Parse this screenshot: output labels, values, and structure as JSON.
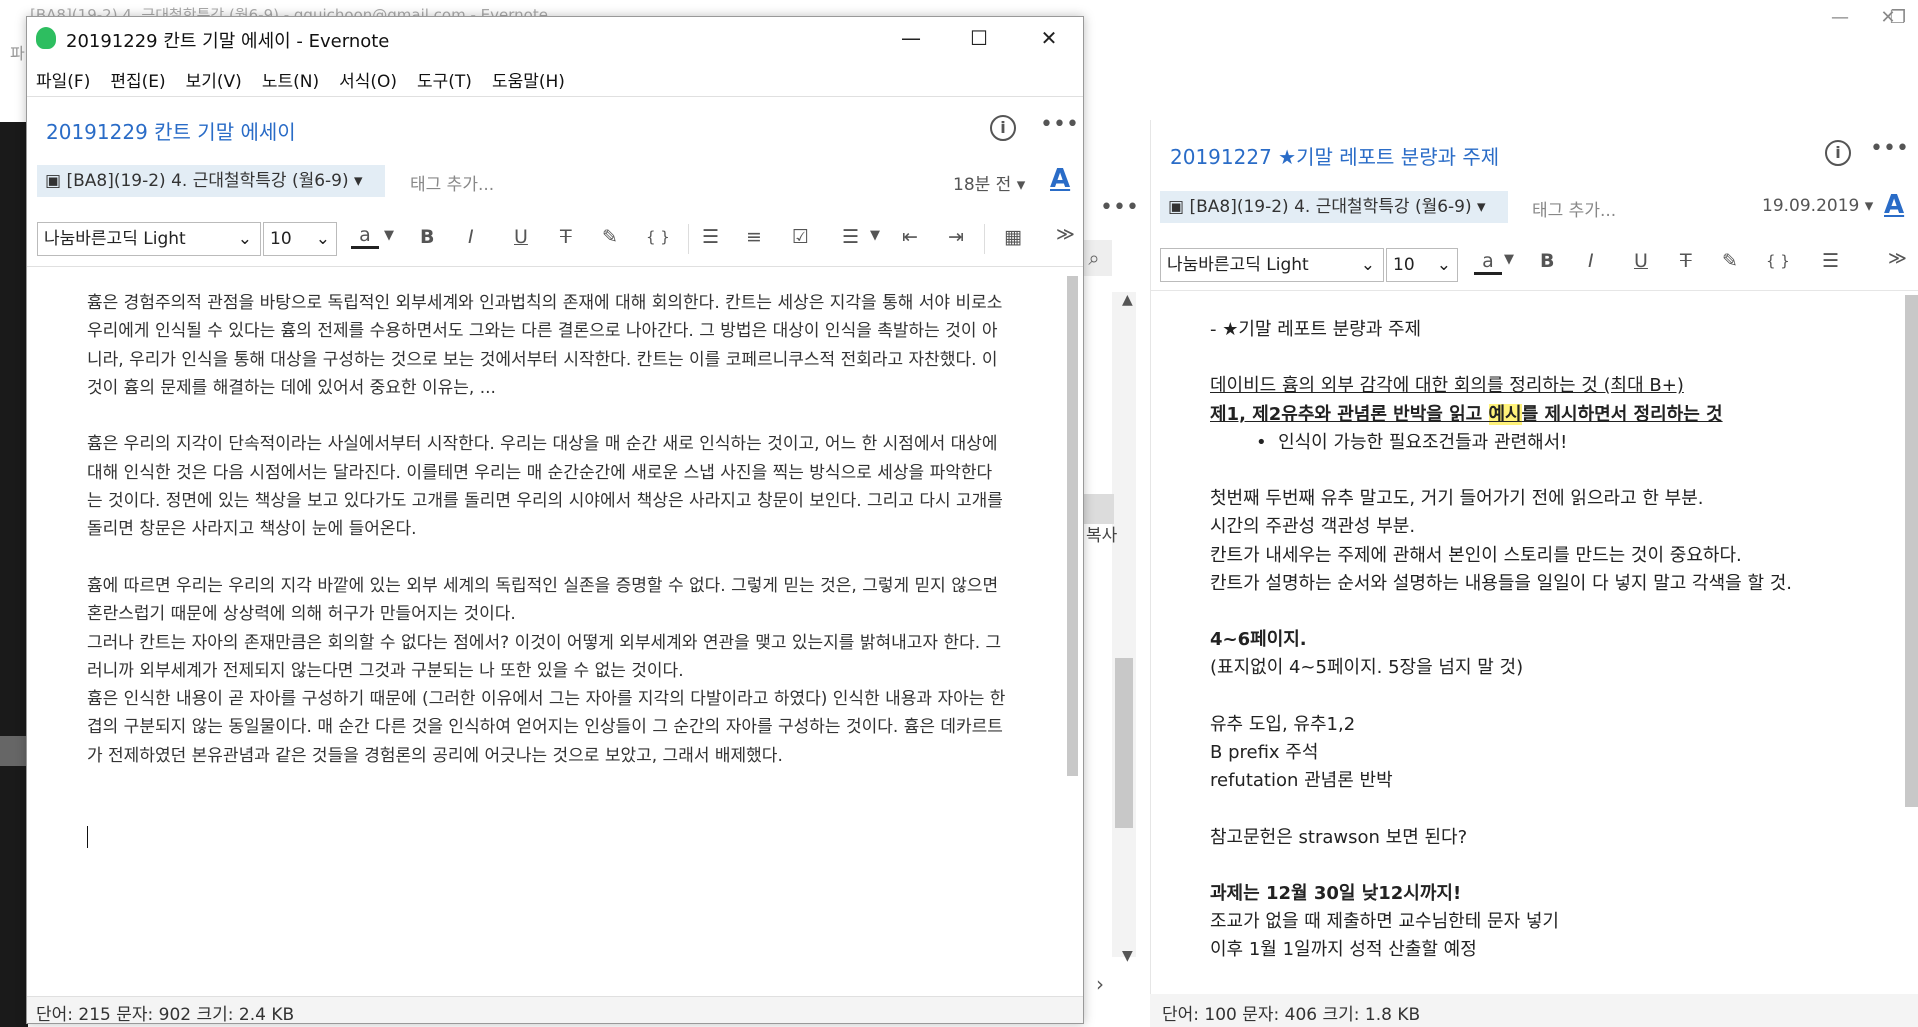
{
  "background_window": {
    "title": "[BA8](19-2) 4. 근대철학특강 (월6-9) - ggujchoon@gmail.com - Evernote",
    "menu_fragment": "파"
  },
  "front_window": {
    "title": "20191229 칸트 기말 에세이 - Evernote",
    "menu": [
      "파일(F)",
      "편집(E)",
      "보기(V)",
      "노트(N)",
      "서식(O)",
      "도구(T)",
      "도움말(H)"
    ],
    "note_title": "20191229 칸트 기말 에세이",
    "notebook": "[BA8](19-2) 4. 근대철학특강 (월6-9)",
    "tag_placeholder": "태그 추가...",
    "updated": "18분 전",
    "toolbar": {
      "font": "나눔바른고딕 Light",
      "size": "10",
      "color_label": "a",
      "bold": "B",
      "italic": "I",
      "underline": "U",
      "strike": "T",
      "code": "{ }"
    },
    "body_paragraphs": [
      "흄은 경험주의적 관점을 바탕으로 독립적인 외부세계와 인과법칙의 존재에 대해 회의한다. 칸트는 세상은 지각을 통해 서야 비로소 우리에게 인식될 수 있다는 흄의 전제를 수용하면서도 그와는 다른 결론으로 나아간다. 그 방법은 대상이 인식을 촉발하는 것이 아니라, 우리가 인식을 통해 대상을 구성하는 것으로 보는 것에서부터 시작한다. 칸트는 이를 코페르니쿠스적 전회라고 자찬했다. 이것이 흄의 문제를 해결하는 데에 있어서 중요한 이유는, ...",
      "",
      "흄은 우리의 지각이 단속적이라는 사실에서부터 시작한다. 우리는 대상을 매 순간 새로 인식하는 것이고, 어느 한 시점에서 대상에 대해 인식한 것은 다음 시점에서는 달라진다. 이를테면 우리는 매 순간순간에 새로운 스냅 사진을 찍는 방식으로 세상을 파악한다는 것이다. 정면에 있는 책상을 보고 있다가도 고개를 돌리면 우리의 시야에서 책상은 사라지고 창문이 보인다. 그리고 다시 고개를 돌리면 창문은 사라지고 책상이 눈에 들어온다.",
      "",
      "흄에 따르면 우리는 우리의 지각 바깥에 있는 외부 세계의 독립적인 실존을 증명할 수 없다. 그렇게 믿는 것은, 그렇게 믿지 않으면 혼란스럽기 때문에 상상력에 의해 허구가 만들어지는 것이다.",
      "그러나 칸트는 자아의 존재만큼은 회의할 수 없다는 점에서? 이것이 어떻게 외부세계와 연관을 맺고 있는지를 밝혀내고자 한다. 그러니까 외부세계가 전제되지 않는다면 그것과 구분되는 나 또한 있을 수 없는 것이다.",
      "흄은 인식한 내용이 곧 자아를 구성하기 때문에 (그러한 이유에서 그는 자아를 지각의 다발이라고 하였다) 인식한 내용과 자아는 한 겹의 구분되지 않는 동일물이다. 매 순간 다른 것을 인식하여 얻어지는 인상들이 그 순간의 자아를 구성하는 것이다. 흄은 데카르트가 전제하였던 본유관념과 같은 것들을 경험론의 공리에 어긋나는 것으로 보았고, 그래서 배제했다."
    ],
    "status": "단어: 215   문자: 902   크기: 2.4 KB"
  },
  "right_pane": {
    "note_title": "20191227 ★기말 레포트 분량과 주제",
    "notebook": "[BA8](19-2) 4. 근대철학특강 (월6-9)",
    "tag_placeholder": "태그 추가...",
    "updated": "19.09.2019",
    "toolbar": {
      "font": "나눔바른고딕 Light",
      "size": "10",
      "color_label": "a",
      "bold": "B",
      "italic": "I",
      "underline": "U",
      "strike": "T",
      "code": "{ }"
    },
    "lines": {
      "l1": "- ★기말 레포트 분량과 주제",
      "l3": "데이비드 흄의 외부 감각에 대한 회의를 정리하는 것 (최대 B+)",
      "l4a": "제1, 제2유추와 관념론 반박을 읽고 ",
      "l4b": "예시",
      "l4c": "를 제시하면서 정리하는 것",
      "l5": "인식이 가능한 필요조건들과 관련해서!",
      "l7": "첫번째 두번째 유추 말고도, 거기 들어가기 전에 읽으라고 한 부분.",
      "l8": "시간의 주관성 객관성 부분.",
      "l9": "칸트가 내세우는 주제에 관해서 본인이 스토리를 만드는 것이 중요하다.",
      "l10": "칸트가 설명하는 순서와 설명하는 내용들을 일일이 다 넣지 말고 각색을 할 것.",
      "l12": "4~6페이지.",
      "l13": "(표지없이 4~5페이지. 5장을 넘지 말 것)",
      "l15": "유추 도입, 유추1,2",
      "l16": "B prefix 주석",
      "l17": "refutation 관념론 반박",
      "l19": "참고문헌은 strawson 보면 된다?",
      "l21": "과제는 12월 30일 낮12시까지!",
      "l22": "조교가 없을 때 제출하면 교수님한테 문자 넣기",
      "l23": "이후 1월 1일까지 성적 산출할 예정"
    },
    "status": "단어: 100   문자: 406   크기: 1.8 KB"
  },
  "middle": {
    "copy_label": "복사"
  },
  "colors": {
    "accent_blue": "#2a6cc7",
    "notebook_chip": "#e3edf5",
    "evernote_green": "#2dbe60",
    "highlight": "#fff27a"
  }
}
